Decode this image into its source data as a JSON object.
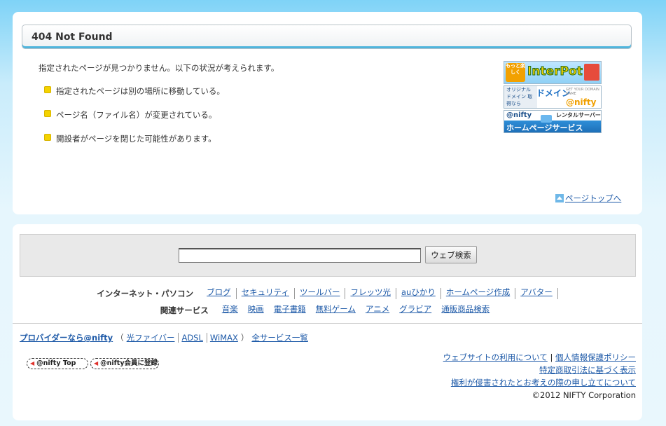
{
  "error": {
    "title": "404 Not Found",
    "intro": "指定されたページが見つかりません。以下の状況が考えられます。",
    "reasons": [
      "指定されたページは別の場所に移動している。",
      "ページ名（ファイル名）が変更されている。",
      "開設者がページを閉じた可能性があります。"
    ],
    "page_top": "ページトップへ"
  },
  "banners": {
    "interpot": {
      "text": "InterPot",
      "badge": "もっと楽しく"
    },
    "domain": {
      "left": "オリジナル ドメイン 取得なら",
      "main": "ドメイン",
      "brand": "@nifty",
      "small": "GET YOUR DOMAIN NAME"
    },
    "homepage": {
      "brand": "@nifty",
      "sub": "レンタルサーバー",
      "main": "ホームページサービス"
    }
  },
  "search": {
    "value": "",
    "button_label": "ウェブ検索"
  },
  "nav": {
    "internet": {
      "heading": "インターネット・パソコン",
      "items": [
        "ブログ",
        "セキュリティ",
        "ツールバー",
        "フレッツ光",
        "auひかり",
        "ホームページ作成",
        "アバター"
      ]
    },
    "related": {
      "heading": "関連サービス",
      "items": [
        "音楽",
        "映画",
        "電子書籍",
        "無料ゲーム",
        "アニメ",
        "グラビア",
        "通販商品検索"
      ]
    }
  },
  "provider": {
    "main": "プロバイダーなら@nifty",
    "open": "（",
    "items": [
      "光ファイバー",
      "ADSL",
      "WiMAX"
    ],
    "close": "）",
    "all_services": "全サービス一覧"
  },
  "buttons": {
    "top": "@nifty Top",
    "signup": "@nifty会員に登録"
  },
  "footer": {
    "terms": "ウェブサイトの利用について",
    "separator": "|",
    "privacy": "個人情報保護ポリシー",
    "commerce": "特定商取引法に基づく表示",
    "rights": "権利が侵害されたとお考えの際の申し立てについて",
    "copyright": "©2012 NIFTY Corporation"
  }
}
